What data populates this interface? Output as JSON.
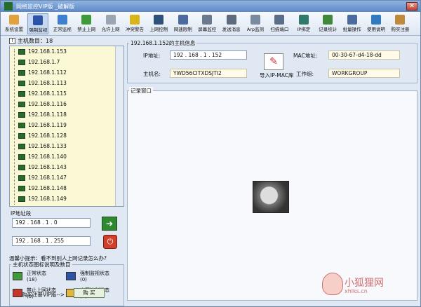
{
  "window": {
    "title": "网络监控VIP版 _破解版"
  },
  "toolbar": [
    {
      "label": "系统设置",
      "icon": "settings-icon",
      "color": "#e2a13a",
      "active": false
    },
    {
      "label": "强制监视",
      "icon": "monitor-icon",
      "color": "#2c55a8",
      "active": true
    },
    {
      "label": "正常监视",
      "icon": "monitor-normal-icon",
      "color": "#3f7fd0",
      "active": false
    },
    {
      "label": "禁止上网",
      "icon": "block-icon",
      "color": "#3f9a3a",
      "active": false
    },
    {
      "label": "允许上网",
      "icon": "allow-icon",
      "color": "#9aa6b3",
      "active": false
    },
    {
      "label": "冲突警告",
      "icon": "warning-icon",
      "color": "#d9b51a",
      "active": false
    },
    {
      "label": "上网控制",
      "icon": "net-control-icon",
      "color": "#2f4f7c",
      "active": false
    },
    {
      "label": "网速限制",
      "icon": "speed-limit-icon",
      "color": "#4a6aa0",
      "active": false
    },
    {
      "label": "屏幕监控",
      "icon": "screen-monitor-icon",
      "color": "#6b7a8c",
      "active": false
    },
    {
      "label": "发送消息",
      "icon": "message-icon",
      "color": "#5d6b7c",
      "active": false
    },
    {
      "label": "Arp监测",
      "icon": "arp-icon",
      "color": "#7a8aa0",
      "active": false
    },
    {
      "label": "扫描端口",
      "icon": "scan-port-icon",
      "color": "#5a6e8a",
      "active": false
    },
    {
      "label": "IP绑定",
      "icon": "ip-bind-icon",
      "color": "#2f7a6a",
      "active": false
    },
    {
      "label": "记录统计",
      "icon": "stats-icon",
      "color": "#3f8a3a",
      "active": false
    },
    {
      "label": "批量操作",
      "icon": "batch-icon",
      "color": "#4a6aa0",
      "active": false
    },
    {
      "label": "使用说明",
      "icon": "help-icon",
      "color": "#2f7ac0",
      "active": false
    },
    {
      "label": "购买注册",
      "icon": "purchase-icon",
      "color": "#c08a3a",
      "active": false
    }
  ],
  "left_panel": {
    "tree_header": "主机数目：18",
    "hosts": [
      "192.168.1.153",
      "192.168.1.7",
      "192.168.1.112",
      "192.168.1.113",
      "192.168.1.115",
      "192.168.1.116",
      "192.168.1.118",
      "192.168.1.119",
      "192.168.1.128",
      "192.168.1.133",
      "192.168.1.140",
      "192.168.1.143",
      "192.168.1.147",
      "192.168.1.148",
      "192.168.1.149"
    ],
    "ip_range_title": "IP地址段",
    "ip_start": "192 . 168 . 1 . 0",
    "ip_end": "192 . 168 . 1 . 255",
    "tip": "温馨小提示：看不到别人上网记录怎么办?",
    "legend_title": "主机状态图标说明及数目",
    "legend": [
      {
        "label": "正常状态",
        "count": "(18)",
        "icon": "normal-state-icon",
        "color": "#3f9a3a"
      },
      {
        "label": "强制监视状态",
        "count": "(0)",
        "icon": "forced-monitor-icon",
        "color": "#2c55a8"
      },
      {
        "label": "禁止上网状态",
        "count": "(0)",
        "icon": "blocked-state-icon",
        "color": "#c8352a"
      },
      {
        "label": "上网控制状态",
        "count": "(0)",
        "icon": "control-state-icon",
        "color": "#e2b63a"
      }
    ],
    "buy_prompt": "购买注册VIP版-->",
    "buy_button": "购 买"
  },
  "right_panel": {
    "host_info_title": "192.168.1.152的主机信息",
    "ip_label": "IP地址:",
    "ip_value": "192 . 168 . 1 . 152",
    "mac_label": "MAC地址:",
    "mac_value": "00-30-67-d4-18-dd",
    "hostname_label": "主机名:",
    "hostname_value": "YWD56CITXDSJTI2",
    "workgroup_label": "工作组:",
    "workgroup_value": "WORKGROUP",
    "import_label": "导入IP-MAC库",
    "log_title": "记录窗口"
  },
  "watermark": {
    "text": "小狐狸网",
    "sub": "xhlks.cn"
  }
}
